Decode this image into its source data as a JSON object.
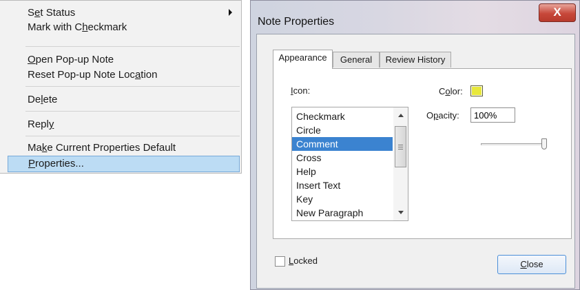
{
  "context_menu": {
    "items": [
      {
        "pre": "S",
        "key": "e",
        "post": "t Status"
      },
      {
        "pre": "Mark with C",
        "key": "h",
        "post": "eckmark"
      },
      {
        "pre": "",
        "key": "O",
        "post": "pen Pop-up Note"
      },
      {
        "pre": "Reset Pop-up Note Loc",
        "key": "a",
        "post": "tion"
      },
      {
        "pre": "De",
        "key": "l",
        "post": "ete"
      },
      {
        "pre": "Repl",
        "key": "y",
        "post": ""
      },
      {
        "pre": "Ma",
        "key": "k",
        "post": "e Current Properties Default"
      },
      {
        "pre": "",
        "key": "P",
        "post": "roperties..."
      }
    ]
  },
  "dialog": {
    "title": "Note Properties",
    "close_glyph": "X",
    "tabs": [
      {
        "label": "Appearance"
      },
      {
        "label": "General"
      },
      {
        "label": "Review History"
      }
    ],
    "icon_label": {
      "pre": "",
      "key": "I",
      "post": "con:"
    },
    "icons": [
      "Checkmark",
      "Circle",
      "Comment",
      "Cross",
      "Help",
      "Insert Text",
      "Key",
      "New Paragraph"
    ],
    "selected_icon": "Comment",
    "color_label": {
      "pre": "C",
      "key": "o",
      "post": "lor:"
    },
    "color_value": "#e8e83a",
    "opacity_label": {
      "pre": "O",
      "key": "p",
      "post": "acity:"
    },
    "opacity_value": "100%",
    "opacity_level": 1.0,
    "locked_label": {
      "pre": "",
      "key": "L",
      "post": "ocked"
    },
    "locked_checked": false,
    "close_button": {
      "pre": "",
      "key": "C",
      "post": "lose"
    }
  }
}
